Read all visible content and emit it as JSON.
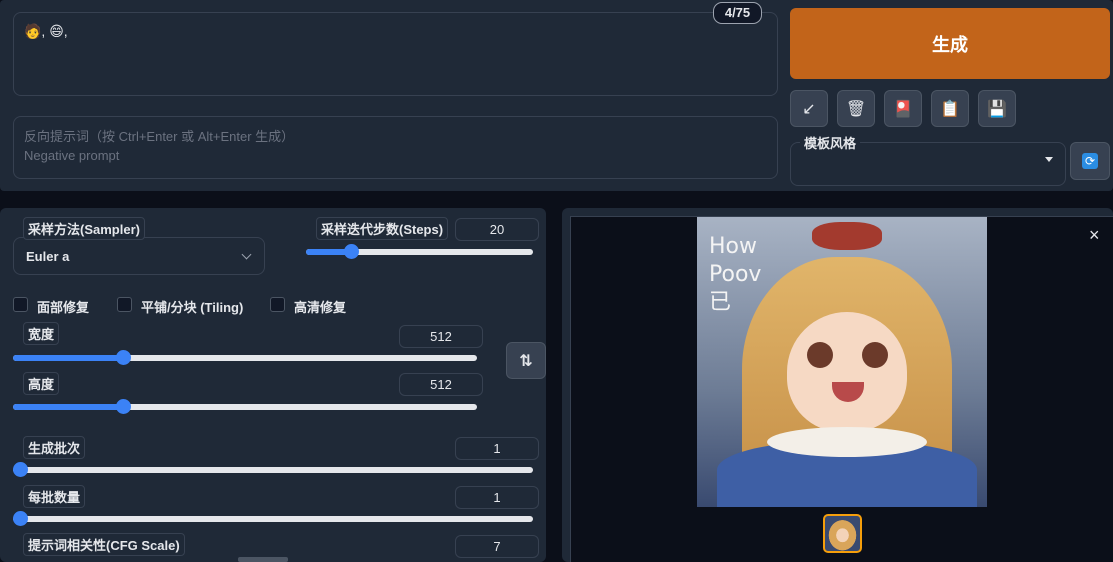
{
  "prompt": {
    "value": "🧑, 😄,",
    "token_counter": "4/75"
  },
  "negative_prompt": {
    "placeholder_line1": "反向提示词（按 Ctrl+Enter 或 Alt+Enter 生成）",
    "placeholder_line2": "Negative prompt"
  },
  "actions": {
    "generate_label": "生成",
    "tools": [
      {
        "icon": "↙",
        "name": "read-params-icon"
      },
      {
        "icon": "🗑",
        "name": "trash-icon"
      },
      {
        "icon": "🎴",
        "name": "card-icon"
      },
      {
        "icon": "📋",
        "name": "clipboard-icon"
      },
      {
        "icon": "💾",
        "name": "save-icon"
      }
    ],
    "style_label": "模板风格",
    "style_value": "",
    "refresh_icon": "🔄"
  },
  "settings": {
    "sampler_label": "采样方法(Sampler)",
    "sampler_value": "Euler a",
    "steps_label": "采样迭代步数(Steps)",
    "steps_value": "20",
    "steps_fraction": 0.2,
    "restore_faces_label": "面部修复",
    "tiling_label": "平铺/分块 (Tiling)",
    "hires_fix_label": "高清修复",
    "width_label": "宽度",
    "width_value": "512",
    "width_fraction": 0.236,
    "height_label": "高度",
    "height_value": "512",
    "height_fraction": 0.236,
    "swap_icon": "⇅",
    "batch_count_label": "生成批次",
    "batch_count_value": "1",
    "batch_count_fraction": 0.0,
    "batch_size_label": "每批数量",
    "batch_size_value": "1",
    "batch_size_fraction": 0.0,
    "cfg_label": "提示词相关性(CFG Scale)",
    "cfg_value": "7"
  },
  "gallery": {
    "close_icon": "×",
    "image_text": "How Poov 已"
  },
  "colors": {
    "generate": "#c2641a",
    "accent": "#3b82f6",
    "panel": "#1f2937",
    "background": "#0b0f19"
  }
}
